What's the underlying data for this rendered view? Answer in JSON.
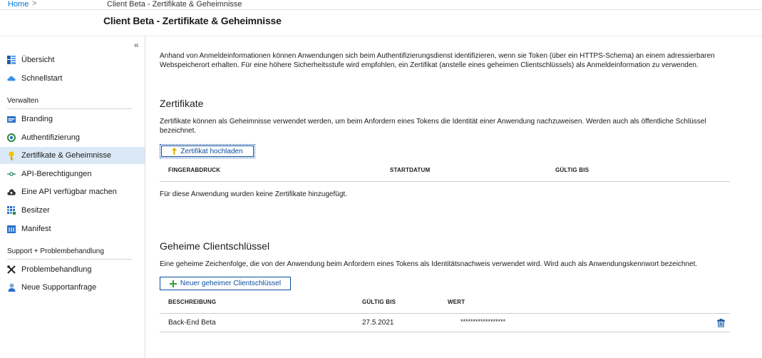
{
  "breadcrumb": {
    "home": "Home",
    "separator": ">",
    "current": "Client Beta - Zertifikate & Geheimnisse"
  },
  "page": {
    "title": "Client Beta - Zertifikate & Geheimnisse"
  },
  "sidebar": {
    "collapse_glyph": "«",
    "top_items": [
      {
        "label": "Übersicht",
        "icon": "overview-icon"
      },
      {
        "label": "Schnellstart",
        "icon": "quickstart-cloud-icon"
      }
    ],
    "section_manage": "Verwalten",
    "manage_items": [
      {
        "label": "Branding",
        "icon": "branding-icon"
      },
      {
        "label": "Authentifizierung",
        "icon": "authentication-icon"
      },
      {
        "label": "Zertifikate & Geheimnisse",
        "icon": "key-icon",
        "active": true
      },
      {
        "label": "API-Berechtigungen",
        "icon": "api-permissions-icon"
      },
      {
        "label": "Eine API verfügbar machen",
        "icon": "expose-api-icon"
      },
      {
        "label": "Besitzer",
        "icon": "owners-icon"
      },
      {
        "label": "Manifest",
        "icon": "manifest-icon"
      }
    ],
    "section_support": "Support + Problembehandlung",
    "support_items": [
      {
        "label": "Problembehandlung",
        "icon": "troubleshoot-icon"
      },
      {
        "label": "Neue Supportanfrage",
        "icon": "support-request-icon"
      }
    ]
  },
  "main": {
    "intro": "Anhand von Anmeldeinformationen können Anwendungen sich beim Authentifizierungsdienst identifizieren, wenn sie Token (über ein HTTPS-Schema) an einem adressierbaren Webspeicherort erhalten. Für eine höhere Sicherheitsstufe wird empfohlen, ein Zertifikat (anstelle eines geheimen Clientschlüssels) als Anmeldeinformation zu verwenden.",
    "certificates": {
      "heading": "Zertifikate",
      "description": "Zertifikate können als Geheimnisse verwendet werden, um beim Anfordern eines Tokens die Identität einer Anwendung nachzuweisen. Werden auch als öffentliche Schlüssel bezeichnet.",
      "upload_button": "Zertifikat hochladen",
      "columns": [
        "FINGERABDRUCK",
        "STARTDATUM",
        "GÜLTIG BIS"
      ],
      "empty_message": "Für diese Anwendung wurden keine Zertifikate hinzugefügt."
    },
    "secrets": {
      "heading": "Geheime Clientschlüssel",
      "description": "Eine geheime Zeichenfolge, die von der Anwendung beim Anfordern eines Tokens als Identitätsnachweis verwendet wird. Wird auch als Anwendungskennwort bezeichnet.",
      "new_button": "Neuer geheimer Clientschlüssel",
      "columns": [
        "BESCHREIBUNG",
        "GÜLTIG BIS",
        "WERT"
      ],
      "rows": [
        {
          "description": "Back-End Beta",
          "expires": "27.5.2021",
          "value": "******************"
        }
      ]
    }
  },
  "colors": {
    "accent": "#0078d4",
    "button_text": "#0b4e9e",
    "active_nav": "#dbe9f7",
    "plus_green": "#2fa12f"
  }
}
